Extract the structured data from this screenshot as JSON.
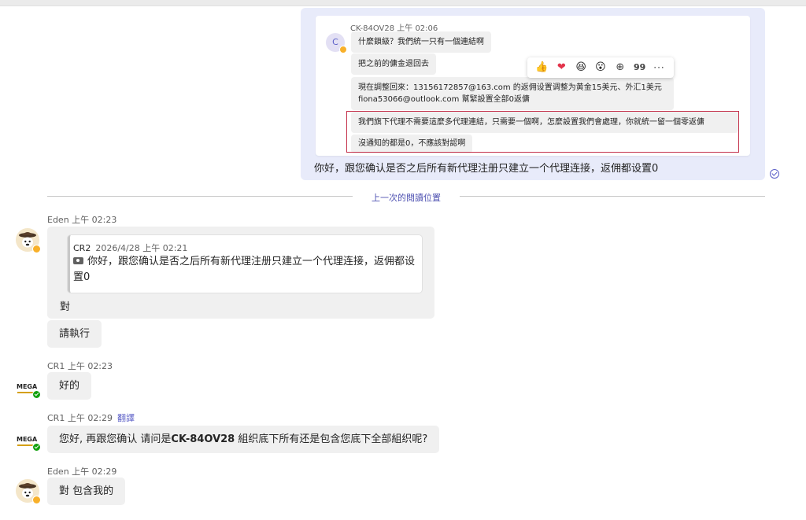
{
  "quoted_thread": {
    "avatar_initial": "C",
    "sender": "CK-84OV28  上午 02:06",
    "msg1": "什麼鎖級？我們統一只有一個連結啊",
    "msg2": "把之前的傭金退回去",
    "msg3_line1": "現在調整回來：13156172857@163.com 的返佣设置调整为黄金15美元、外汇1美元",
    "msg3_line2": "fiona53066@outlook.com 幫緊設置全部0返傭",
    "msg4": "我們旗下代理不需要這麼多代理連結，只需要一個啊，怎麼設置我們會處理，你就統一留一個零返傭",
    "msg5": "沒通知的都是0，不應該對認啊"
  },
  "reactions": {
    "like": "👍",
    "heart": "❤",
    "laugh": "😆",
    "surprised": "😮",
    "add": "⊕",
    "quote": "99",
    "more": "···"
  },
  "outgoing_text": "你好，跟您确认是否之后所有新代理注册只建立一个代理连接，返佣都设置0",
  "divider_label": "上一次的閱讀位置",
  "messages": {
    "m1_sender": "Eden  上午 02:23",
    "m1_reply_author": "CR2",
    "m1_reply_time": "2026/4/28 上午 02:21",
    "m1_reply_text": "你好，跟您确认是否之后所有新代理注册只建立一个代理连接，返佣都设置0",
    "m1_text": "對",
    "m1_text2": "請執行",
    "m2_sender": "CR1  上午 02:23",
    "m2_text": "好的",
    "m3_sender": "CR1  上午 02:29",
    "m3_translate": "翻譯",
    "m3_text_a": "您好, 再跟您确认 请问是",
    "m3_text_b": "CK-84OV28",
    "m3_text_c": " 組织底下所有还是包含您底下全部組织呢?",
    "m4_sender": "Eden  上午 02:29",
    "m4_text": "對 包含我的",
    "mega_logo": "MEGA"
  },
  "colors": {
    "accent": "#5b5fc7",
    "outgoing_bg": "#e8ebfa",
    "highlight_border": "#c4314b",
    "online": "#13a10e",
    "away": "#f8b02a"
  }
}
